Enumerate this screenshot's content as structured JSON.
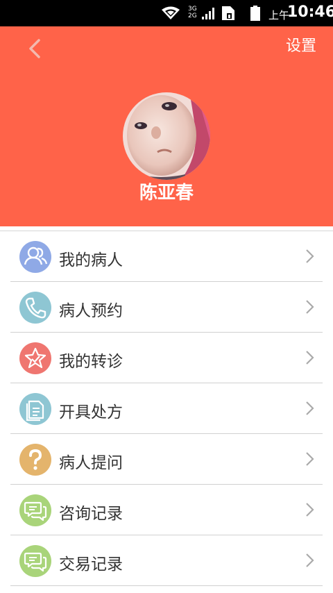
{
  "status_bar": {
    "network_label_top": "3G",
    "network_label_bottom": "2G",
    "ampm": "上午",
    "time": "10:46"
  },
  "header": {
    "settings_label": "设置",
    "username": "陈亚春",
    "background_color": "#ff6349"
  },
  "menu": {
    "items": [
      {
        "label": "我的病人",
        "icon": "patients-icon",
        "color": "#8fa9e6"
      },
      {
        "label": "病人预约",
        "icon": "phone-icon",
        "color": "#8ec6d3"
      },
      {
        "label": "我的转诊",
        "icon": "star-check-icon",
        "color": "#ef7670"
      },
      {
        "label": "开具处方",
        "icon": "document-icon",
        "color": "#8ec6d3"
      },
      {
        "label": "病人提问",
        "icon": "question-icon",
        "color": "#e4b46c"
      },
      {
        "label": "咨询记录",
        "icon": "chat-icon",
        "color": "#a9d47a"
      },
      {
        "label": "交易记录",
        "icon": "chat-icon",
        "color": "#a9d47a"
      }
    ]
  }
}
